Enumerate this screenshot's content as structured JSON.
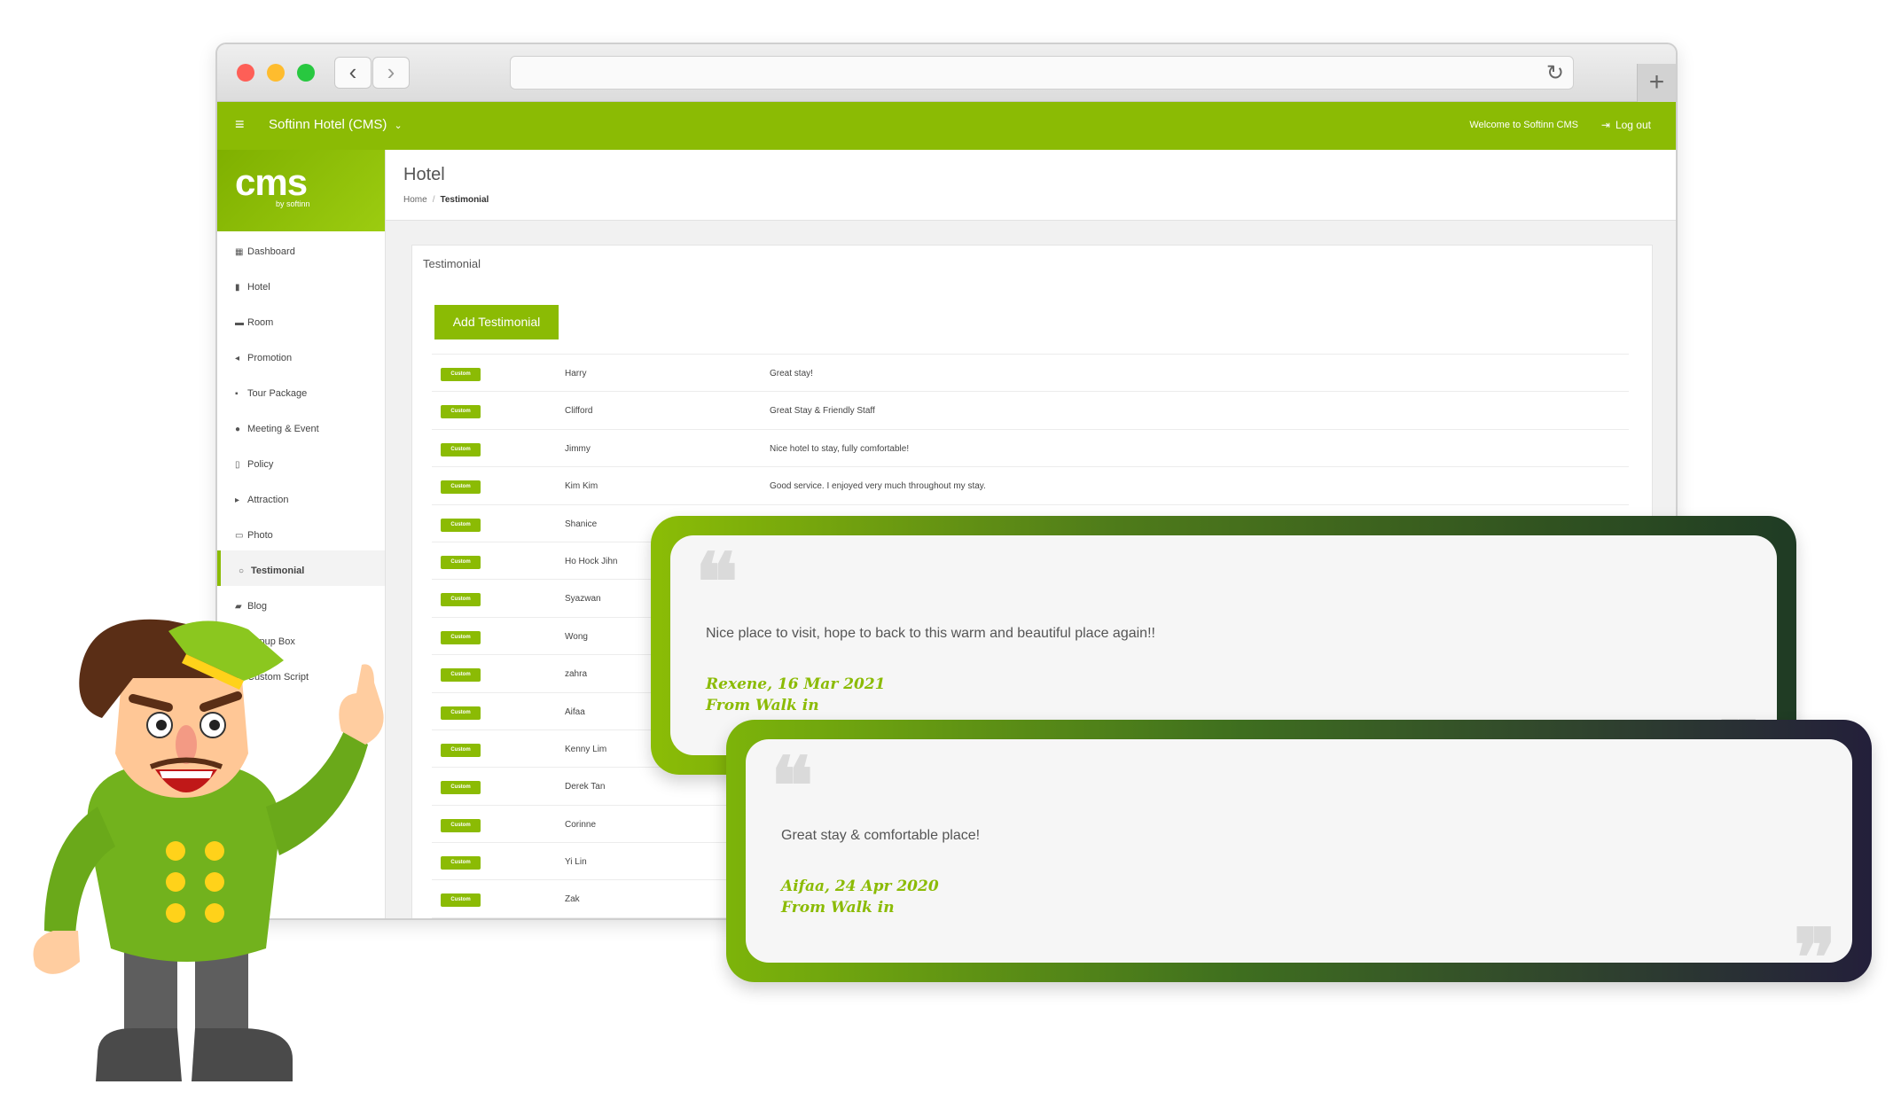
{
  "browser": {
    "back_glyph": "‹",
    "forward_glyph": "›",
    "reload_glyph": "↻",
    "newtab_glyph": "+"
  },
  "header": {
    "menu_glyph": "≡",
    "title": "Softinn Hotel (CMS)",
    "dropdown_glyph": "⌄",
    "welcome": "Welcome to Softinn CMS",
    "logout": "Log out",
    "logout_glyph": "⇥"
  },
  "logo": {
    "main": "cms",
    "sub": "by softinn"
  },
  "sidebar": {
    "items": [
      {
        "label": "Dashboard",
        "icon": "▦"
      },
      {
        "label": "Hotel",
        "icon": "▮"
      },
      {
        "label": "Room",
        "icon": "▬"
      },
      {
        "label": "Promotion",
        "icon": "◂"
      },
      {
        "label": "Tour Package",
        "icon": "▪"
      },
      {
        "label": "Meeting & Event",
        "icon": "●"
      },
      {
        "label": "Policy",
        "icon": "▯"
      },
      {
        "label": "Attraction",
        "icon": "▸"
      },
      {
        "label": "Photo",
        "icon": "▭"
      },
      {
        "label": "Testimonial",
        "icon": "○"
      },
      {
        "label": "Blog",
        "icon": "▰"
      },
      {
        "label": "Popup Box",
        "icon": "▣"
      },
      {
        "label": "Custom Script",
        "icon": "◆"
      }
    ]
  },
  "page": {
    "title": "Hotel",
    "breadcrumb_home": "Home",
    "breadcrumb_sep": "/",
    "breadcrumb_current": "Testimonial",
    "panel_title": "Testimonial",
    "add_button": "Add Testimonial"
  },
  "testimonials": [
    {
      "badge": "Custom",
      "name": "Harry",
      "message": "Great stay!"
    },
    {
      "badge": "Custom",
      "name": "Clifford",
      "message": "Great Stay & Friendly Staff"
    },
    {
      "badge": "Custom",
      "name": "Jimmy",
      "message": "Nice hotel to stay, fully comfortable!"
    },
    {
      "badge": "Custom",
      "name": "Kim Kim",
      "message": "Good service. I enjoyed very much throughout my stay."
    },
    {
      "badge": "Custom",
      "name": "Shanice",
      "message": ""
    },
    {
      "badge": "Custom",
      "name": "Ho Hock Jihn",
      "message": ""
    },
    {
      "badge": "Custom",
      "name": "Syazwan",
      "message": ""
    },
    {
      "badge": "Custom",
      "name": "Wong",
      "message": ""
    },
    {
      "badge": "Custom",
      "name": "zahra",
      "message": ""
    },
    {
      "badge": "Custom",
      "name": "Aifaa",
      "message": ""
    },
    {
      "badge": "Custom",
      "name": "Kenny Lim",
      "message": ""
    },
    {
      "badge": "Custom",
      "name": "Derek Tan",
      "message": ""
    },
    {
      "badge": "Custom",
      "name": "Corinne",
      "message": ""
    },
    {
      "badge": "Custom",
      "name": "Yi Lin",
      "message": ""
    },
    {
      "badge": "Custom",
      "name": "Zak",
      "message": ""
    }
  ],
  "cards": [
    {
      "quote_open": "❝",
      "quote_close": "❞",
      "text": "Nice place to visit, hope to back to this warm and beautiful place again!!",
      "author": "Rexene, 16 Mar 2021",
      "source": "From Walk in"
    },
    {
      "quote_open": "❝",
      "quote_close": "❞",
      "text": "Great stay & comfortable place!",
      "author": "Aifaa, 24 Apr 2020",
      "source": "From Walk in"
    }
  ],
  "colors": {
    "brand_green": "#8bbb04",
    "card_gradient_end": "#1f3b24"
  }
}
